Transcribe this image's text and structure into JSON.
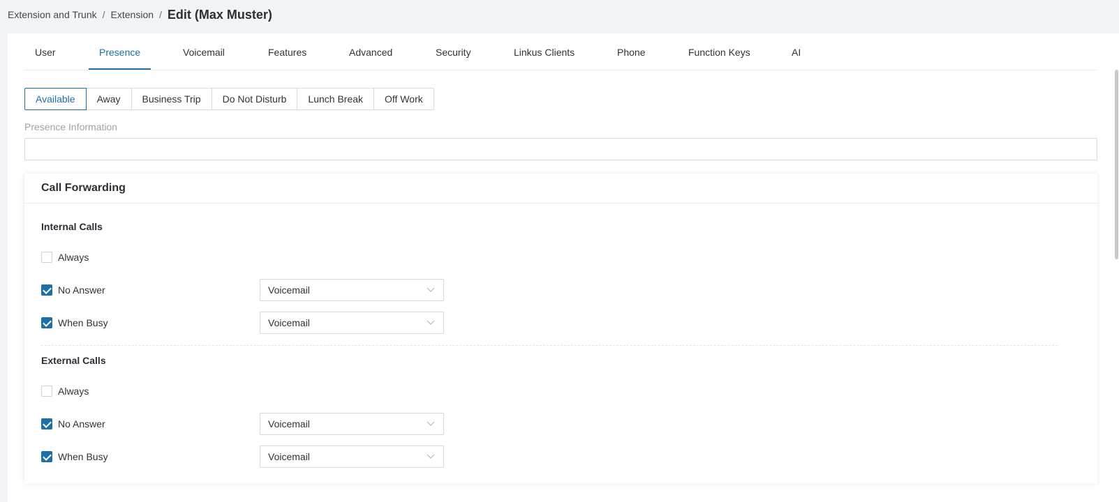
{
  "breadcrumb": {
    "items": [
      "Extension and Trunk",
      "Extension"
    ],
    "separator": "/",
    "current": "Edit (Max Muster)"
  },
  "tabs": [
    "User",
    "Presence",
    "Voicemail",
    "Features",
    "Advanced",
    "Security",
    "Linkus Clients",
    "Phone",
    "Function Keys",
    "AI"
  ],
  "active_tab": "Presence",
  "presence_options": [
    "Available",
    "Away",
    "Business Trip",
    "Do Not Disturb",
    "Lunch Break",
    "Off Work"
  ],
  "active_presence": "Available",
  "presence_information": {
    "label": "Presence Information",
    "value": ""
  },
  "call_forwarding": {
    "title": "Call Forwarding",
    "internal": {
      "title": "Internal Calls",
      "always": {
        "label": "Always",
        "checked": false
      },
      "no_answer": {
        "label": "No Answer",
        "checked": true,
        "value": "Voicemail"
      },
      "when_busy": {
        "label": "When Busy",
        "checked": true,
        "value": "Voicemail"
      }
    },
    "external": {
      "title": "External Calls",
      "always": {
        "label": "Always",
        "checked": false
      },
      "no_answer": {
        "label": "No Answer",
        "checked": true,
        "value": "Voicemail"
      },
      "when_busy": {
        "label": "When Busy",
        "checked": true,
        "value": "Voicemail"
      }
    }
  },
  "colors": {
    "accent": "#1d6fa5",
    "page_background": "#f3f4f7",
    "border": "#d9d9d9"
  }
}
